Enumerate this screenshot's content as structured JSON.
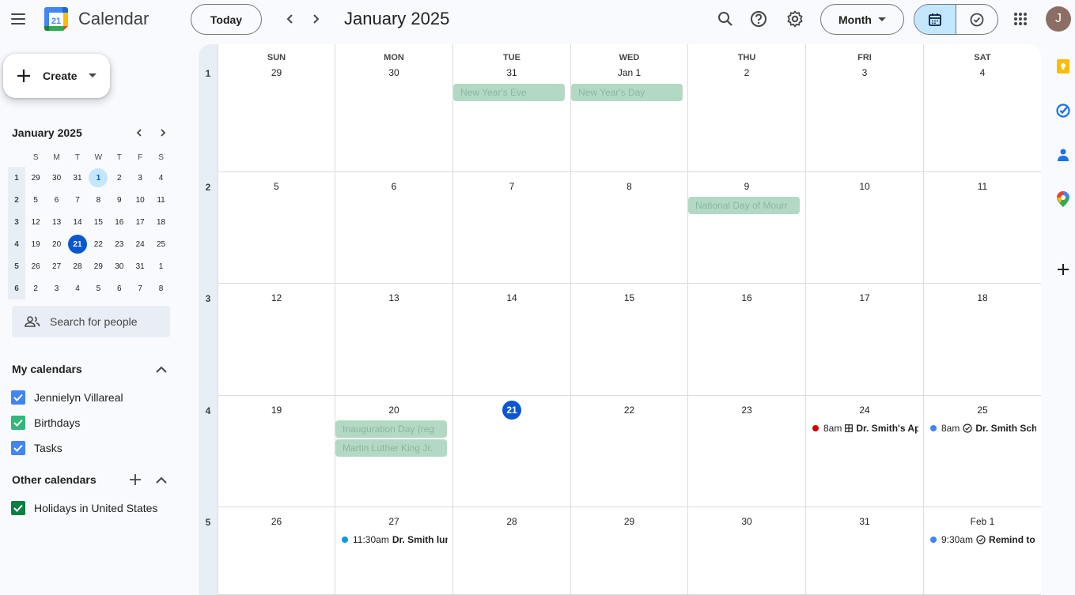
{
  "header": {
    "app_title": "Calendar",
    "logo_day": "21",
    "today_label": "Today",
    "month_title": "January 2025",
    "view_label": "Month",
    "avatar_letter": "J"
  },
  "sidebar": {
    "create_label": "Create",
    "mini": {
      "title": "January 2025",
      "dow": [
        "S",
        "M",
        "T",
        "W",
        "T",
        "F",
        "S"
      ],
      "weeks": [
        {
          "wk": "1",
          "days": [
            "29",
            "30",
            "31",
            "1",
            "2",
            "3",
            "4"
          ]
        },
        {
          "wk": "2",
          "days": [
            "5",
            "6",
            "7",
            "8",
            "9",
            "10",
            "11"
          ]
        },
        {
          "wk": "3",
          "days": [
            "12",
            "13",
            "14",
            "15",
            "16",
            "17",
            "18"
          ]
        },
        {
          "wk": "4",
          "days": [
            "19",
            "20",
            "21",
            "22",
            "23",
            "24",
            "25"
          ]
        },
        {
          "wk": "5",
          "days": [
            "26",
            "27",
            "28",
            "29",
            "30",
            "31",
            "1"
          ]
        },
        {
          "wk": "6",
          "days": [
            "2",
            "3",
            "4",
            "5",
            "6",
            "7",
            "8"
          ]
        }
      ]
    },
    "search_people_placeholder": "Search for people",
    "my_calendars_title": "My calendars",
    "my_calendars": [
      {
        "label": "Jennielyn Villareal",
        "color": "#4285f4"
      },
      {
        "label": "Birthdays",
        "color": "#33b679"
      },
      {
        "label": "Tasks",
        "color": "#4285f4"
      }
    ],
    "other_calendars_title": "Other calendars",
    "other_calendars": [
      {
        "label": "Holidays in United States",
        "color": "#0b8043"
      }
    ]
  },
  "grid": {
    "dow": [
      "SUN",
      "MON",
      "TUE",
      "WED",
      "THU",
      "FRI",
      "SAT"
    ],
    "weeks": [
      {
        "wk": "1",
        "days": [
          "29",
          "30",
          "31",
          "Jan 1",
          "2",
          "3",
          "4"
        ]
      },
      {
        "wk": "2",
        "days": [
          "5",
          "6",
          "7",
          "8",
          "9",
          "10",
          "11"
        ]
      },
      {
        "wk": "3",
        "days": [
          "12",
          "13",
          "14",
          "15",
          "16",
          "17",
          "18"
        ]
      },
      {
        "wk": "4",
        "days": [
          "19",
          "20",
          "21",
          "22",
          "23",
          "24",
          "25"
        ]
      },
      {
        "wk": "5",
        "days": [
          "26",
          "27",
          "28",
          "29",
          "30",
          "31",
          "Feb 1"
        ]
      }
    ],
    "holidays": {
      "new_years_eve": "New Year's Eve",
      "new_years_day": "New Year's Day",
      "national_day_mourning": "National Day of Mourr",
      "inauguration": "Inauguration Day (reg",
      "mlk": "Martin Luther King Jr."
    },
    "events": {
      "jan24": {
        "time": "8am",
        "title": "Dr. Smith's Ap",
        "color": "#d50000"
      },
      "jan25": {
        "time": "8am",
        "title": "Dr. Smith Sch",
        "color": "#4285f4"
      },
      "jan27": {
        "time": "11:30am",
        "title": "Dr. Smith lun",
        "color": "#039be5"
      },
      "feb1": {
        "time": "9:30am",
        "title": "Remind to",
        "color": "#4285f4"
      }
    }
  },
  "colors": {
    "accent": "#0b57d0",
    "holiday_chip": "#b3d9c5",
    "selected": "#c2e7ff"
  }
}
